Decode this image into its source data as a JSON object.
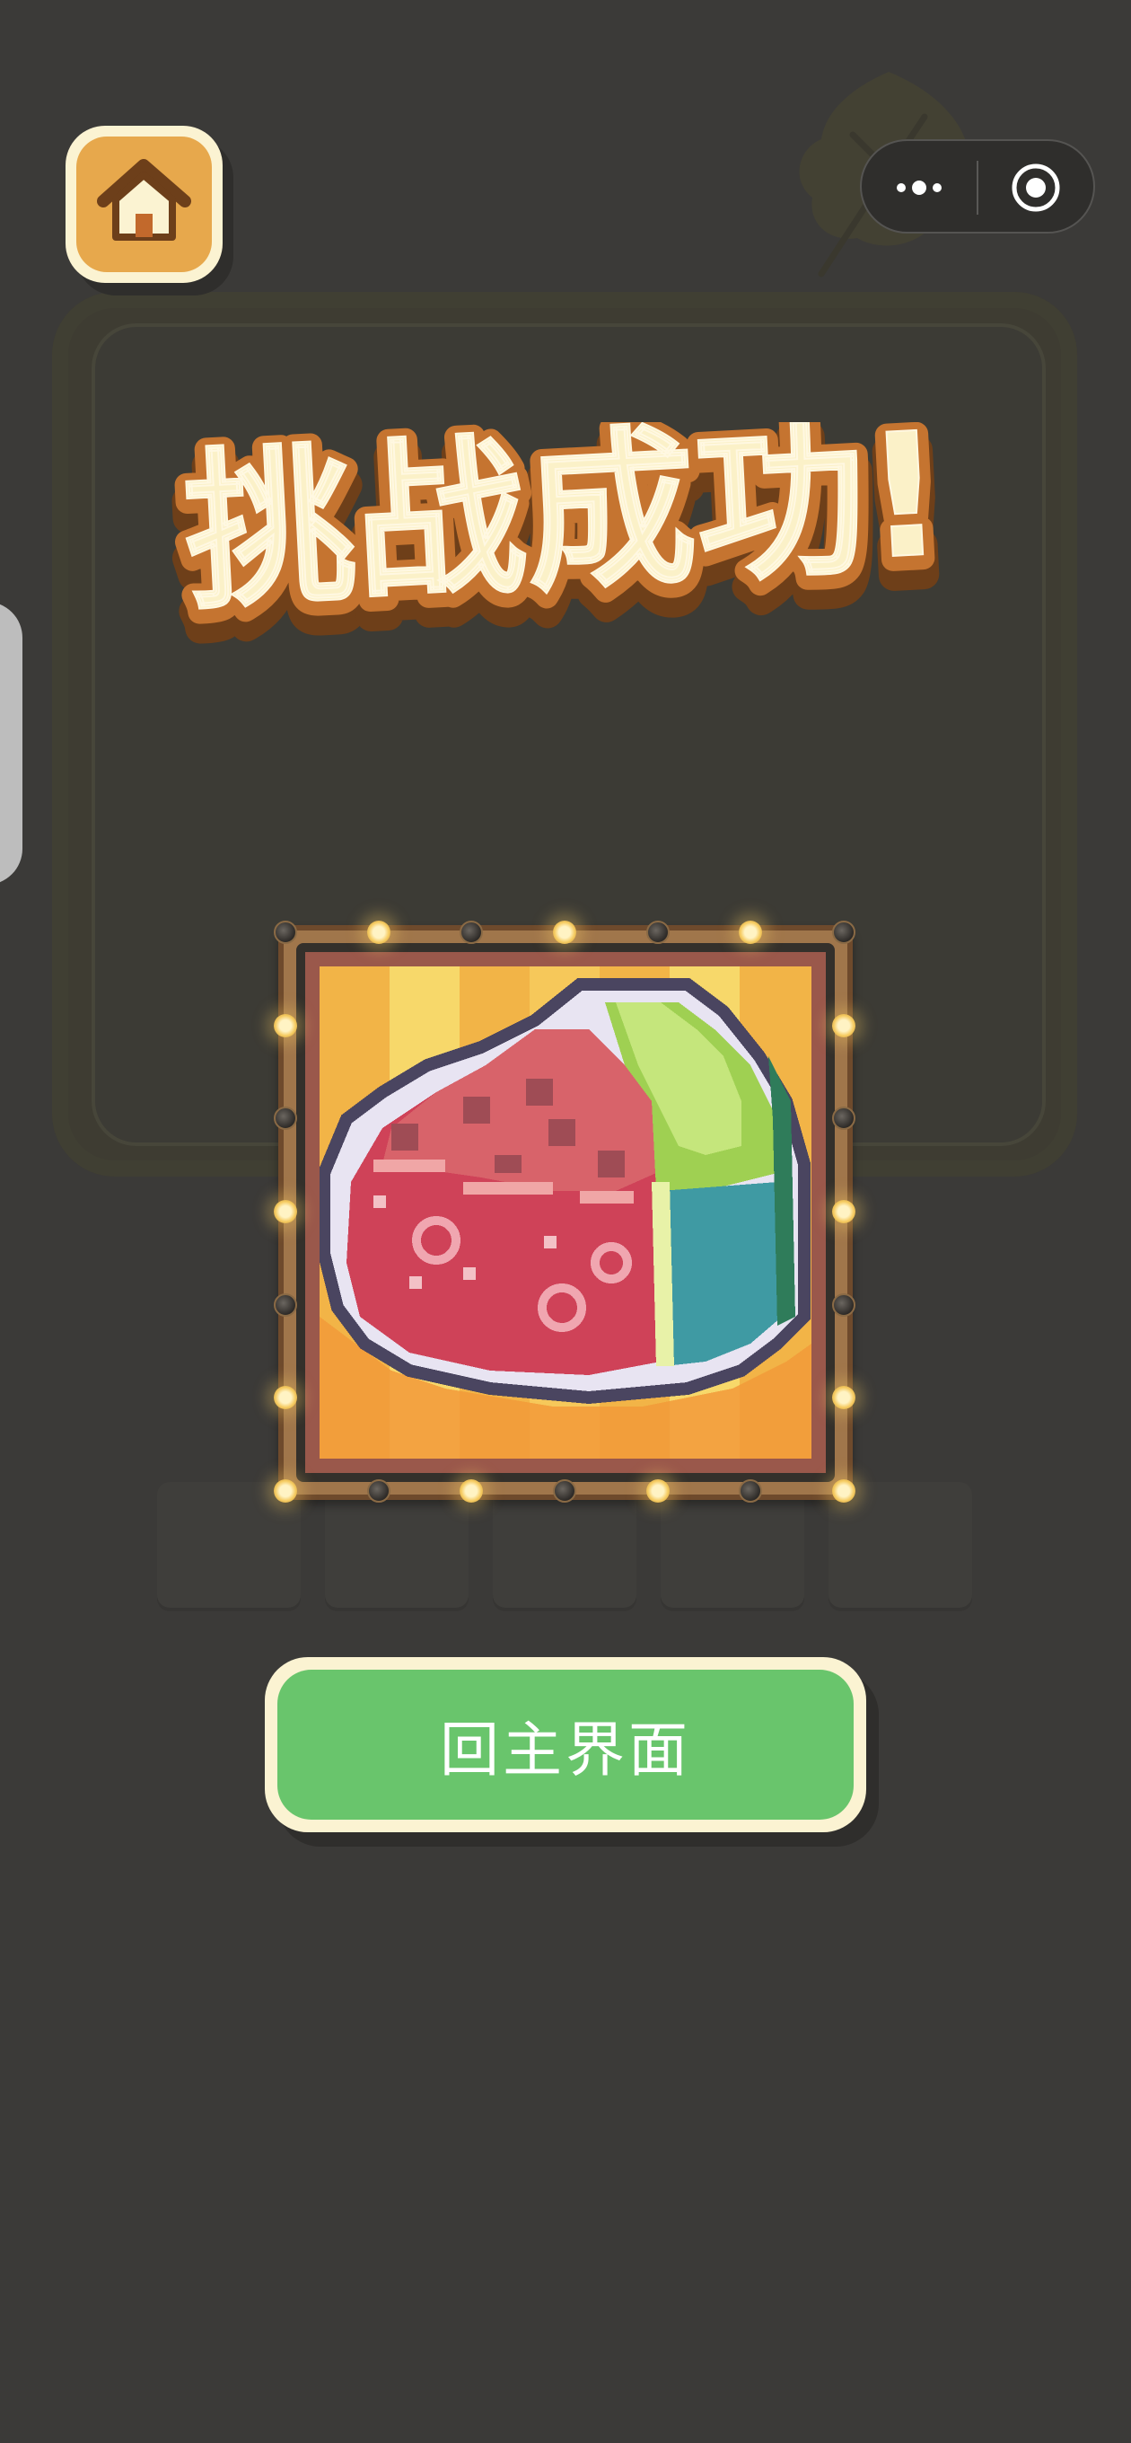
{
  "header": {
    "home_button": {
      "icon": "home-icon"
    },
    "capsule": {
      "more_icon": "more-dots-icon",
      "close_icon": "target-circle-icon"
    }
  },
  "result": {
    "title": "挑战成功!"
  },
  "reward_picture": {
    "subject": "pixel-art watermelon slice"
  },
  "actions": {
    "back_to_main_label": "回主界面"
  },
  "colors": {
    "background": "#3b3a38",
    "button_green": "#69c56c",
    "home_orange": "#e7a84c",
    "title_cream": "#fbf1c8",
    "title_outline": "#b8682a"
  }
}
